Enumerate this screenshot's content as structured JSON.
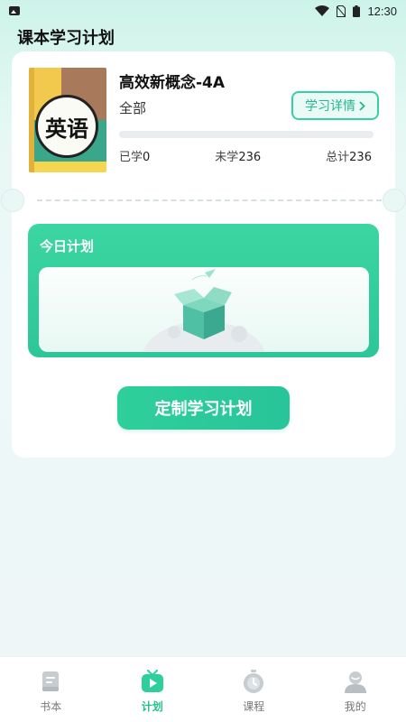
{
  "status_bar": {
    "time": "12:30"
  },
  "page": {
    "title": "课本学习计划"
  },
  "book": {
    "cover_text": "英语",
    "title": "高效新概念-4A",
    "scope": "全部",
    "detail_button_label": "学习详情",
    "progress": 0,
    "stats": {
      "learned_label": "已学",
      "learned_value": "0",
      "unlearned_label": "未学",
      "unlearned_value": "236",
      "total_label": "总计",
      "total_value": "236"
    }
  },
  "today_plan": {
    "title": "今日计划"
  },
  "custom_plan_button": {
    "label": "定制学习计划"
  },
  "bottom_nav": {
    "items": [
      {
        "label": "书本",
        "icon": "book-icon",
        "active": false
      },
      {
        "label": "计划",
        "icon": "plan-tv-icon",
        "active": true
      },
      {
        "label": "课程",
        "icon": "stopwatch-icon",
        "active": false
      },
      {
        "label": "我的",
        "icon": "profile-icon",
        "active": false
      }
    ]
  },
  "colors": {
    "accent": "#2fcf9b",
    "accent_dark": "#23b98e"
  }
}
